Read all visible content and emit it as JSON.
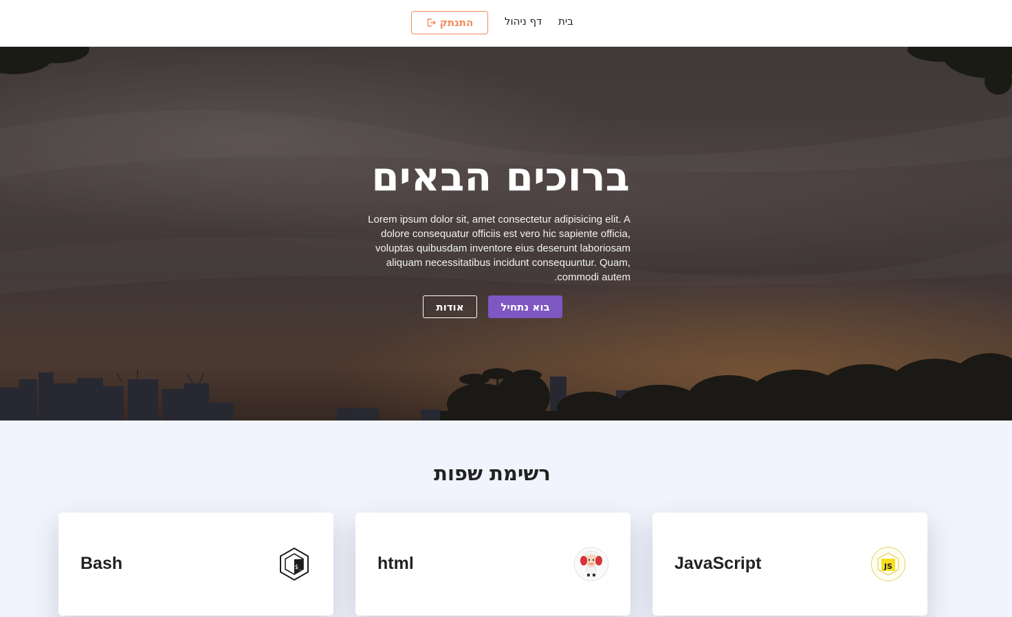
{
  "nav": {
    "home": "בית",
    "admin": "דף ניהול",
    "logout": "התנתק",
    "logout_icon": "logout-icon",
    "accent_color": "#f08a5d"
  },
  "hero": {
    "title": "ברוכים הבאים",
    "text": "Lorem ipsum dolor sit, amet consectetur adipisicing elit. A dolore consequatur officiis est vero hic sapiente officia, voluptas quibusdam inventore eius deserunt laboriosam aliquam necessitatibus incidunt consequuntur. Quam, commodi autem.",
    "start_button": "בוא נתחיל",
    "about_button": "אודות",
    "primary_color": "#7e57c2"
  },
  "languages": {
    "title": "רשימת שפות",
    "cards": [
      {
        "name": "JavaScript",
        "icon": "javascript-icon"
      },
      {
        "name": "html",
        "icon": "html-mascot-icon"
      },
      {
        "name": "Bash",
        "icon": "bash-icon"
      }
    ]
  }
}
